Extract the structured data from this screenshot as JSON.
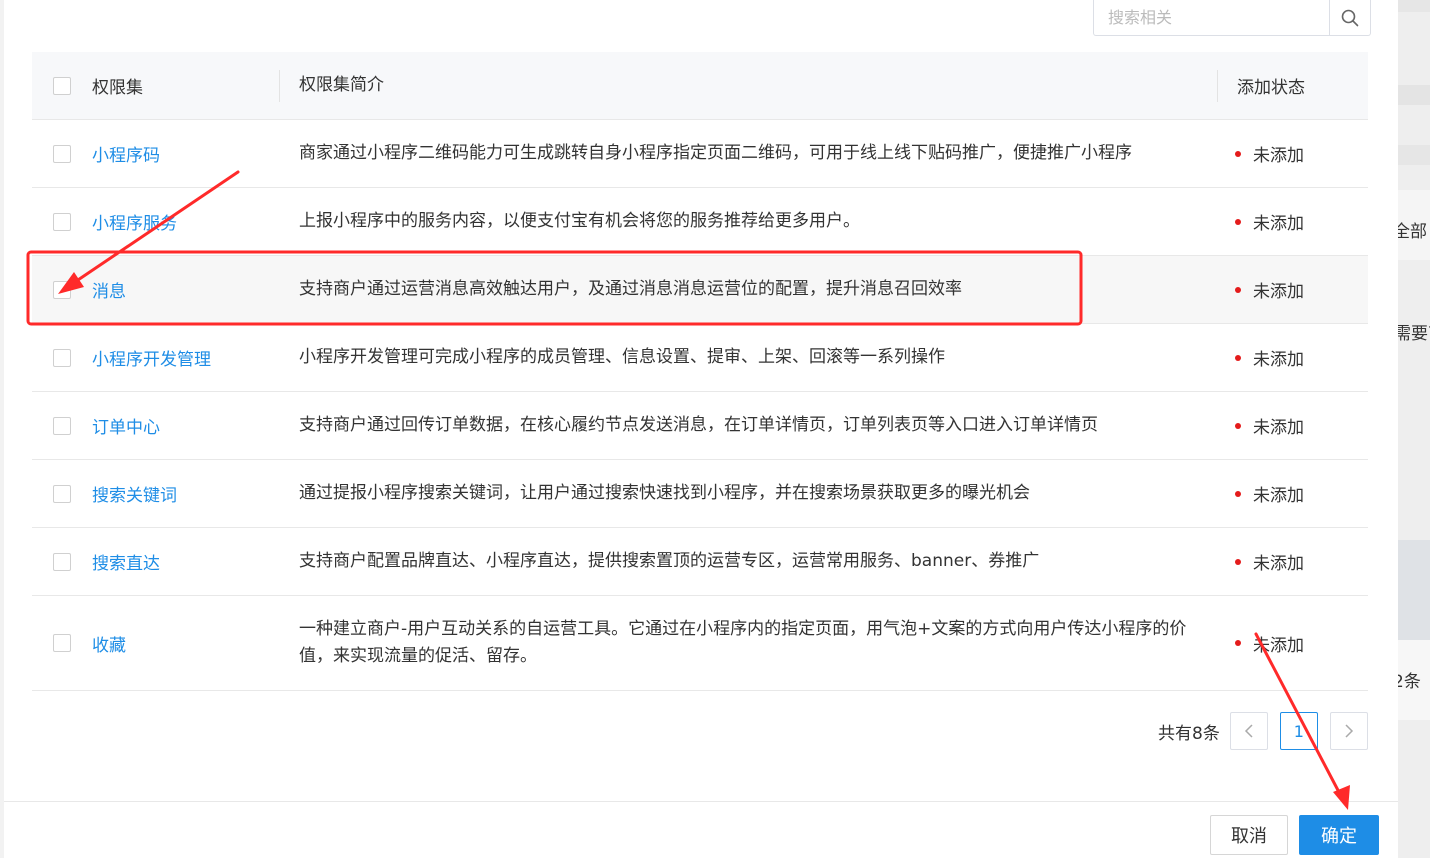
{
  "search": {
    "placeholder": "搜索相关",
    "icon": "search-icon"
  },
  "table": {
    "columns": {
      "name": "权限集",
      "desc": "权限集简介",
      "status": "添加状态"
    },
    "rows": [
      {
        "name": "小程序码",
        "desc": "商家通过小程序二维码能力可生成跳转自身小程序指定页面二维码，可用于线上线下贴码推广，便捷推广小程序",
        "status": "未添加"
      },
      {
        "name": "小程序服务",
        "desc": "上报小程序中的服务内容，以便支付宝有机会将您的服务推荐给更多用户。",
        "status": "未添加"
      },
      {
        "name": "消息",
        "desc": "支持商户通过运营消息高效触达用户，及通过消息消息运营位的配置，提升消息召回效率",
        "status": "未添加"
      },
      {
        "name": "小程序开发管理",
        "desc": "小程序开发管理可完成小程序的成员管理、信息设置、提审、上架、回滚等一系列操作",
        "status": "未添加"
      },
      {
        "name": "订单中心",
        "desc": "支持商户通过回传订单数据，在核心履约节点发送消息，在订单详情页，订单列表页等入口进入订单详情页",
        "status": "未添加"
      },
      {
        "name": "搜索关键词",
        "desc": "通过提报小程序搜索关键词，让用户通过搜索快速找到小程序，并在搜索场景获取更多的曝光机会",
        "status": "未添加"
      },
      {
        "name": "搜索直达",
        "desc": "支持商户配置品牌直达、小程序直达，提供搜索置顶的运营专区，运营常用服务、banner、券推广",
        "status": "未添加"
      },
      {
        "name": "收藏",
        "desc": "一种建立商户-用户互动关系的自运营工具。它通过在小程序内的指定页面，用气泡+文案的方式向用户传达小程序的价值，来实现流量的促活、留存。",
        "status": "未添加"
      }
    ]
  },
  "pagination": {
    "total": "共有8条",
    "current_page": "1"
  },
  "footer": {
    "cancel_label": "取消",
    "ok_label": "确定"
  },
  "background_fragments": {
    "frag1": "全部",
    "frag2": "需要商",
    "frag3": "2条"
  },
  "colors": {
    "primary": "#1e8de6",
    "status_dot": "#e41b1b",
    "annotation": "#ff2a2a"
  }
}
